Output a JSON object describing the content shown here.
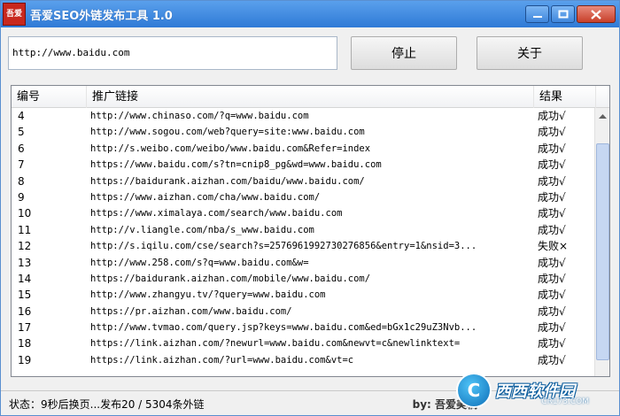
{
  "window": {
    "title": "吾爱SEO外链发布工具 1.0",
    "logo_text": "吾爱"
  },
  "toolbar": {
    "url_value": "http://www.baidu.com",
    "stop_label": "停止",
    "about_label": "关于"
  },
  "table": {
    "headers": [
      "编号",
      "推广链接",
      "结果"
    ],
    "rows": [
      {
        "id": "4",
        "link": "http://www.chinaso.com/?q=www.baidu.com",
        "result": "成功√"
      },
      {
        "id": "5",
        "link": "http://www.sogou.com/web?query=site:www.baidu.com",
        "result": "成功√"
      },
      {
        "id": "6",
        "link": "http://s.weibo.com/weibo/www.baidu.com&Refer=index",
        "result": "成功√"
      },
      {
        "id": "7",
        "link": "https://www.baidu.com/s?tn=cnip8_pg&wd=www.baidu.com",
        "result": "成功√"
      },
      {
        "id": "8",
        "link": "https://baidurank.aizhan.com/baidu/www.baidu.com/",
        "result": "成功√"
      },
      {
        "id": "9",
        "link": "https://www.aizhan.com/cha/www.baidu.com/",
        "result": "成功√"
      },
      {
        "id": "10",
        "link": "https://www.ximalaya.com/search/www.baidu.com",
        "result": "成功√"
      },
      {
        "id": "11",
        "link": "http://v.liangle.com/nba/s_www.baidu.com",
        "result": "成功√"
      },
      {
        "id": "12",
        "link": "http://s.iqilu.com/cse/search?s=2576961992730276856&entry=1&nsid=3...",
        "result": "失败×"
      },
      {
        "id": "13",
        "link": "http://www.258.com/s?q=www.baidu.com&w=",
        "result": "成功√"
      },
      {
        "id": "14",
        "link": "https://baidurank.aizhan.com/mobile/www.baidu.com/",
        "result": "成功√"
      },
      {
        "id": "15",
        "link": "http://www.zhangyu.tv/?query=www.baidu.com",
        "result": "成功√"
      },
      {
        "id": "16",
        "link": "https://pr.aizhan.com/www.baidu.com/",
        "result": "成功√"
      },
      {
        "id": "17",
        "link": "http://www.tvmao.com/query.jsp?keys=www.baidu.com&ed=bGx1c29uZ3Nvb...",
        "result": "成功√"
      },
      {
        "id": "18",
        "link": "https://link.aizhan.com/?newurl=www.baidu.com&newvt=c&newlinktext=",
        "result": "成功√"
      },
      {
        "id": "19",
        "link": "https://link.aizhan.com/?url=www.baidu.com&vt=c",
        "result": "成功√"
      }
    ]
  },
  "status": {
    "text": "状态：9秒后换页...发布20 / 5304条外链",
    "right_text": "by: 吾爱美稿"
  },
  "watermark": {
    "brand": "西西软件园",
    "sub": "CR173.COM",
    "mark": "C"
  }
}
